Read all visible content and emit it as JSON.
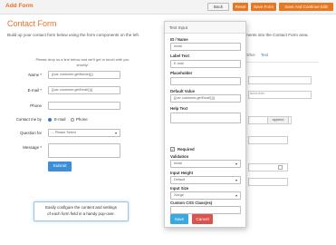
{
  "header": {
    "app_title": "Add Form",
    "back_label": "Back",
    "reset_label": "Reset",
    "save_label": "Save Form",
    "save_continue_label": "Save And Continue Edit"
  },
  "page": {
    "title": "Contact Form",
    "intro": "Build up your contact form below using the form components on the left.",
    "intro_tail": "ments into the Contact Form area."
  },
  "form": {
    "intro_line1": "Please drop us a line below and we'll get in touch with you",
    "intro_line2": "shortly!",
    "fields": {
      "name_label": "Name *",
      "name_value": "{{var customer.getName()}}",
      "email_label": "E-mail *",
      "email_value": "{{var customer.getEmail()}}",
      "phone_label": "Phone",
      "contact_label": "Contact me by",
      "contact_options": [
        "E-mail",
        "Phone"
      ],
      "question_label": "Question for",
      "question_value": "-- Please Select",
      "message_label": "Message *"
    },
    "submit_label": "Submit"
  },
  "callout": {
    "line1": "Easily configure the content and settings",
    "line2": "of each form field in a handy pop-over."
  },
  "background_right": {
    "tab_other": "Other",
    "tab_text": "Text",
    "placeholder_text": "aceholder",
    "append_label": "append"
  },
  "popover": {
    "title": "Text Input",
    "id_label": "ID / Name",
    "id_value": "email",
    "label_label": "Label Text",
    "label_value": "E-mail",
    "placeholder_label": "Placeholder",
    "placeholder_value": "",
    "default_label": "Default Value",
    "default_value": "{{var customer.getEmail()}}",
    "help_label": "Help Text",
    "help_value": "",
    "required_label": "Required",
    "validation_label": "Validation",
    "validation_value": "email",
    "height_label": "Input Height",
    "height_value": "Default",
    "size_label": "Input Size",
    "size_value": "Xlarge",
    "css_label": "Custom CSS Class(es)",
    "css_value": "",
    "save_label": "Save",
    "cancel_label": "Cancel"
  },
  "colors": {
    "accent_orange": "#e87722",
    "submit_blue": "#3a8fd8",
    "save_blue": "#3ba8e0",
    "cancel_red": "#d9534f"
  }
}
